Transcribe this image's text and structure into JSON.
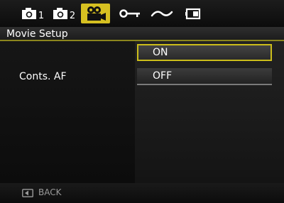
{
  "tabs": [
    {
      "icon": "camera-icon",
      "number": "1"
    },
    {
      "icon": "camera-icon",
      "number": "2"
    },
    {
      "icon": "movie-camera-icon",
      "number": ""
    },
    {
      "icon": "key-icon",
      "number": ""
    },
    {
      "icon": "wave-icon",
      "number": ""
    },
    {
      "icon": "battery-icon",
      "number": ""
    }
  ],
  "active_tab_index": 2,
  "header": {
    "title": "Movie Setup"
  },
  "setting": {
    "label": "Conts. AF"
  },
  "options": [
    {
      "label": "ON",
      "selected": true
    },
    {
      "label": "OFF",
      "selected": false
    }
  ],
  "footer": {
    "back_label": "BACK",
    "back_icon": "back-button-icon"
  },
  "colors": {
    "accent": "#d6c021",
    "highlight_border": "#cbbd1b",
    "header_rule": "#8c861e"
  }
}
